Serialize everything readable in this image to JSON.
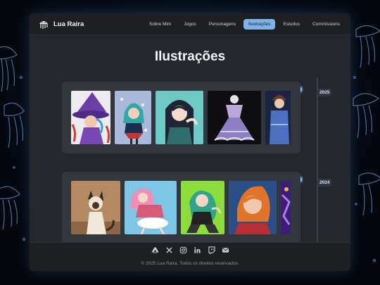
{
  "brand": {
    "name": "Lua Raira"
  },
  "nav": {
    "items": [
      {
        "label": "Sobre Mim"
      },
      {
        "label": "Jogos"
      },
      {
        "label": "Personagens"
      },
      {
        "label": "Ilustrações",
        "active": true
      },
      {
        "label": "Estudos"
      },
      {
        "label": "Commissions"
      }
    ]
  },
  "page": {
    "title": "Ilustrações"
  },
  "timeline": [
    {
      "year": "2025",
      "thumbnails": [
        {
          "icon": "witch-illustration"
        },
        {
          "icon": "teal-hair-girl-illustration"
        },
        {
          "icon": "hooded-girl-illustration"
        },
        {
          "icon": "lace-dress-illustration"
        },
        {
          "icon": "blue-outfit-girl-illustration"
        }
      ]
    },
    {
      "year": "2024",
      "thumbnails": [
        {
          "icon": "siamese-cat-illustration"
        },
        {
          "icon": "pink-hair-girl-illustration"
        },
        {
          "icon": "green-haired-girl-illustration"
        },
        {
          "icon": "red-hair-portrait-illustration"
        },
        {
          "icon": "purple-illustration"
        }
      ]
    }
  ],
  "footer": {
    "social_icons": [
      "artstation-icon",
      "x-icon",
      "instagram-icon",
      "linkedin-icon",
      "twitch-icon",
      "email-icon"
    ],
    "copyright": "© 2025 Lua Raira. Todos os direitos reservados."
  },
  "colors": {
    "accent": "#7fb2ea",
    "panel": "#24272c",
    "card": "#32363d",
    "navbar": "#1d1f23"
  }
}
